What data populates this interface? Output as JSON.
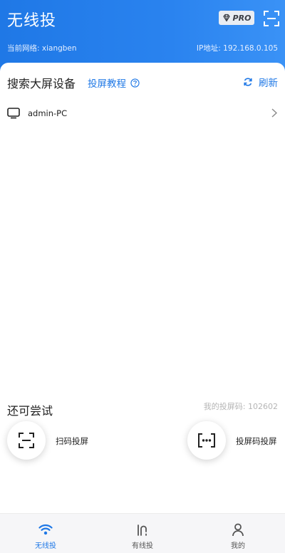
{
  "header": {
    "title": "无线投",
    "pro_badge": "PRO",
    "network_label": "当前网络: xiangben",
    "ip_label": "IP地址: 192.168.0.105"
  },
  "search": {
    "title": "搜索大屏设备",
    "tutorial_link": "投屏教程",
    "refresh_label": "刷新"
  },
  "devices": [
    {
      "name": "admin-PC"
    }
  ],
  "try_section": {
    "title": "还可尝试",
    "cast_code_label": "我的投屏码: 102602",
    "actions": [
      {
        "label": "扫码投屏",
        "icon": "scan-icon"
      },
      {
        "label": "投屏码投屏",
        "icon": "code-dots-icon"
      }
    ]
  },
  "tabs": [
    {
      "label": "无线投",
      "icon": "wifi-icon",
      "active": true
    },
    {
      "label": "有线投",
      "icon": "cable-icon",
      "active": false
    },
    {
      "label": "我的",
      "icon": "person-icon",
      "active": false
    }
  ],
  "colors": {
    "primary": "#1f78e6",
    "header_gradient_end": "#3a92f6",
    "muted_text": "#b5b5b5",
    "tabbar_bg": "#f6f6f8"
  }
}
